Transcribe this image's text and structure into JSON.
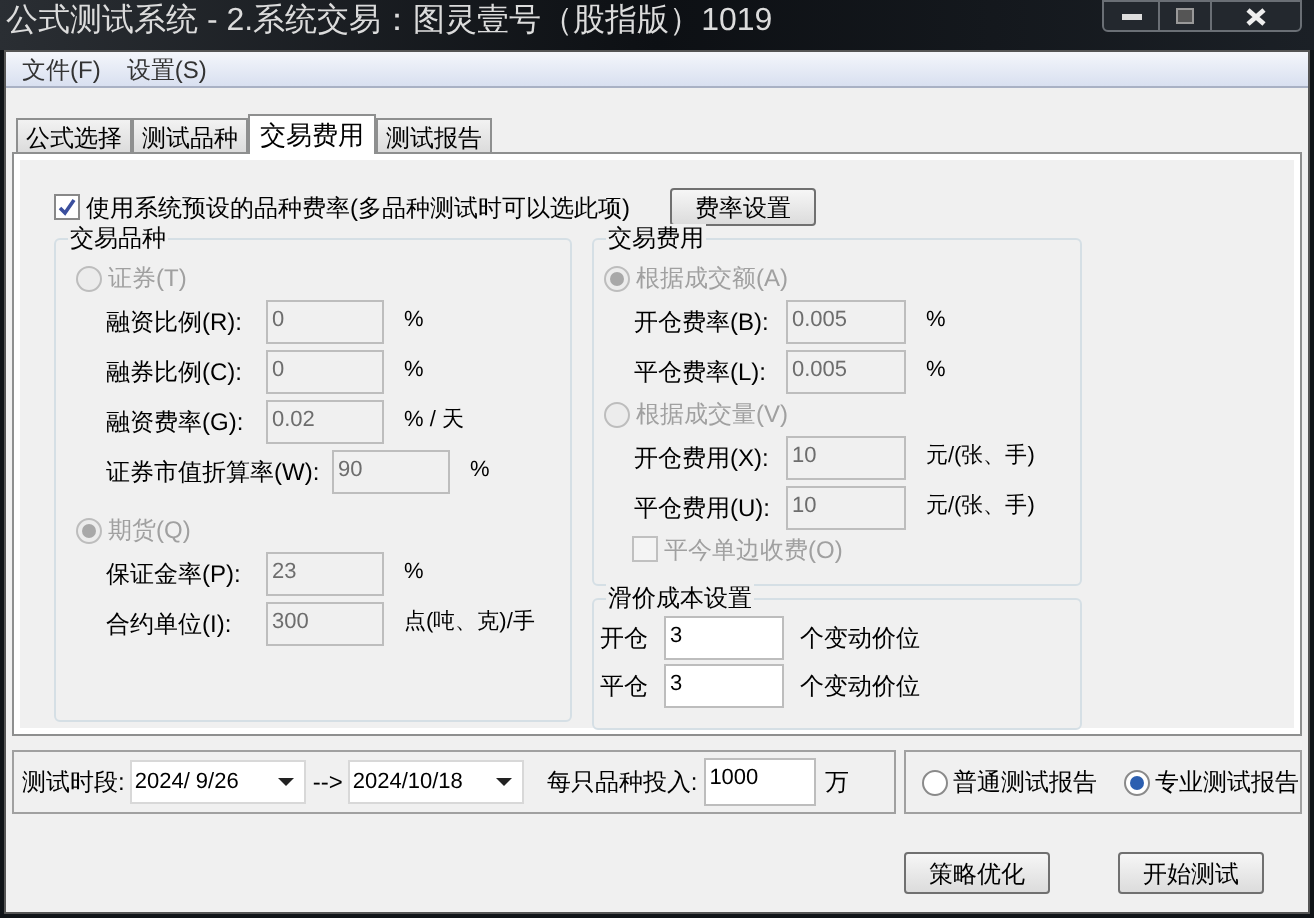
{
  "window": {
    "title": "公式测试系统 - 2.系统交易：图灵壹号（股指版）1019"
  },
  "menu": [
    {
      "label": "文件(F)"
    },
    {
      "label": "设置(S)"
    }
  ],
  "tabs": [
    {
      "label": "公式选择",
      "selected": false
    },
    {
      "label": "测试品种",
      "selected": false
    },
    {
      "label": "交易费用",
      "selected": true
    },
    {
      "label": "测试报告",
      "selected": false
    }
  ],
  "use_preset_rates": {
    "label": "使用系统预设的品种费率(多品种测试时可以选此项)",
    "checked": true
  },
  "rate_settings_button": "费率设置",
  "instrument_group": {
    "title": "交易品种",
    "options": [
      {
        "label": "证券(T)",
        "selected": false,
        "disabled": true,
        "fields": [
          {
            "label": "融资比例(R):",
            "value": "0",
            "unit": "%"
          },
          {
            "label": "融券比例(C):",
            "value": "0",
            "unit": "%"
          },
          {
            "label": "融资费率(G):",
            "value": "0.02",
            "unit": "% / 天"
          },
          {
            "label": "证券市值折算率(W):",
            "value": "90",
            "unit": "%"
          }
        ]
      },
      {
        "label": "期货(Q)",
        "selected": true,
        "disabled": true,
        "fields": [
          {
            "label": "保证金率(P):",
            "value": "23",
            "unit": "%"
          },
          {
            "label": "合约单位(I):",
            "value": "300",
            "unit": "点(吨、克)/手"
          }
        ]
      }
    ]
  },
  "fee_group": {
    "title": "交易费用",
    "options": [
      {
        "label": "根据成交额(A)",
        "selected": true,
        "disabled": true,
        "fields": [
          {
            "label": "开仓费率(B):",
            "value": "0.005",
            "unit": "%"
          },
          {
            "label": "平仓费率(L):",
            "value": "0.005",
            "unit": "%"
          }
        ]
      },
      {
        "label": "根据成交量(V)",
        "selected": false,
        "disabled": true,
        "fields": [
          {
            "label": "开仓费用(X):",
            "value": "10",
            "unit": "元/(张、手)"
          },
          {
            "label": "平仓费用(U):",
            "value": "10",
            "unit": "元/(张、手)"
          }
        ]
      }
    ],
    "single_side": {
      "label": "平今单边收费(O)",
      "checked": false,
      "disabled": true
    }
  },
  "slippage_group": {
    "title": "滑价成本设置",
    "rows": [
      {
        "label": "开仓",
        "value": "3",
        "unit": "个变动价位"
      },
      {
        "label": "平仓",
        "value": "3",
        "unit": "个变动价位"
      }
    ]
  },
  "period": {
    "label": "测试时段:",
    "start": "2024/ 9/26",
    "arrow": "-->",
    "end": "2024/10/18"
  },
  "investment": {
    "label": "每只品种投入:",
    "value": "1000",
    "unit": "万"
  },
  "report_type": [
    {
      "label": "普通测试报告",
      "selected": false
    },
    {
      "label": "专业测试报告",
      "selected": true
    }
  ],
  "buttons": [
    {
      "label": "策略优化"
    },
    {
      "label": "开始测试"
    }
  ]
}
